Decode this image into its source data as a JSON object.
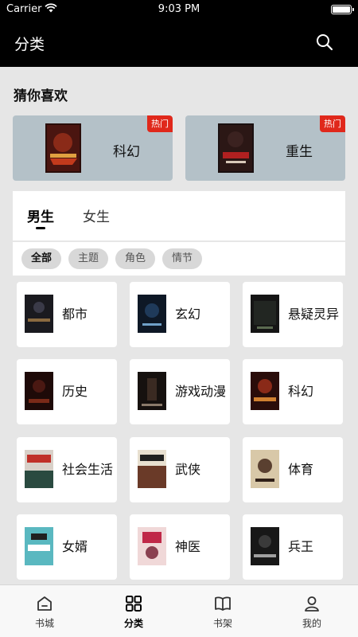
{
  "status_bar": {
    "carrier": "Carrier",
    "time": "9:03 PM",
    "battery_level": 1.0
  },
  "header": {
    "title": "分类",
    "search_icon": "search-icon"
  },
  "recommend": {
    "title": "猜你喜欢",
    "items": [
      {
        "name": "科幻",
        "badge": "热门"
      },
      {
        "name": "重生",
        "badge": "热门"
      }
    ]
  },
  "gender_tabs": [
    {
      "label": "男生",
      "active": true
    },
    {
      "label": "女生",
      "active": false
    }
  ],
  "filters": [
    {
      "label": "全部",
      "active": true
    },
    {
      "label": "主题",
      "active": false
    },
    {
      "label": "角色",
      "active": false
    },
    {
      "label": "情节",
      "active": false
    }
  ],
  "categories": [
    {
      "label": "都市"
    },
    {
      "label": "玄幻"
    },
    {
      "label": "悬疑灵异"
    },
    {
      "label": "历史"
    },
    {
      "label": "游戏动漫"
    },
    {
      "label": "科幻"
    },
    {
      "label": "社会生活"
    },
    {
      "label": "武侠"
    },
    {
      "label": "体育"
    },
    {
      "label": "女婿"
    },
    {
      "label": "神医"
    },
    {
      "label": "兵王"
    }
  ],
  "tab_bar": [
    {
      "label": "书城",
      "icon": "home-icon",
      "active": false
    },
    {
      "label": "分类",
      "icon": "category-grid-icon",
      "active": true
    },
    {
      "label": "书架",
      "icon": "open-book-icon",
      "active": false
    },
    {
      "label": "我的",
      "icon": "user-icon",
      "active": false
    }
  ]
}
